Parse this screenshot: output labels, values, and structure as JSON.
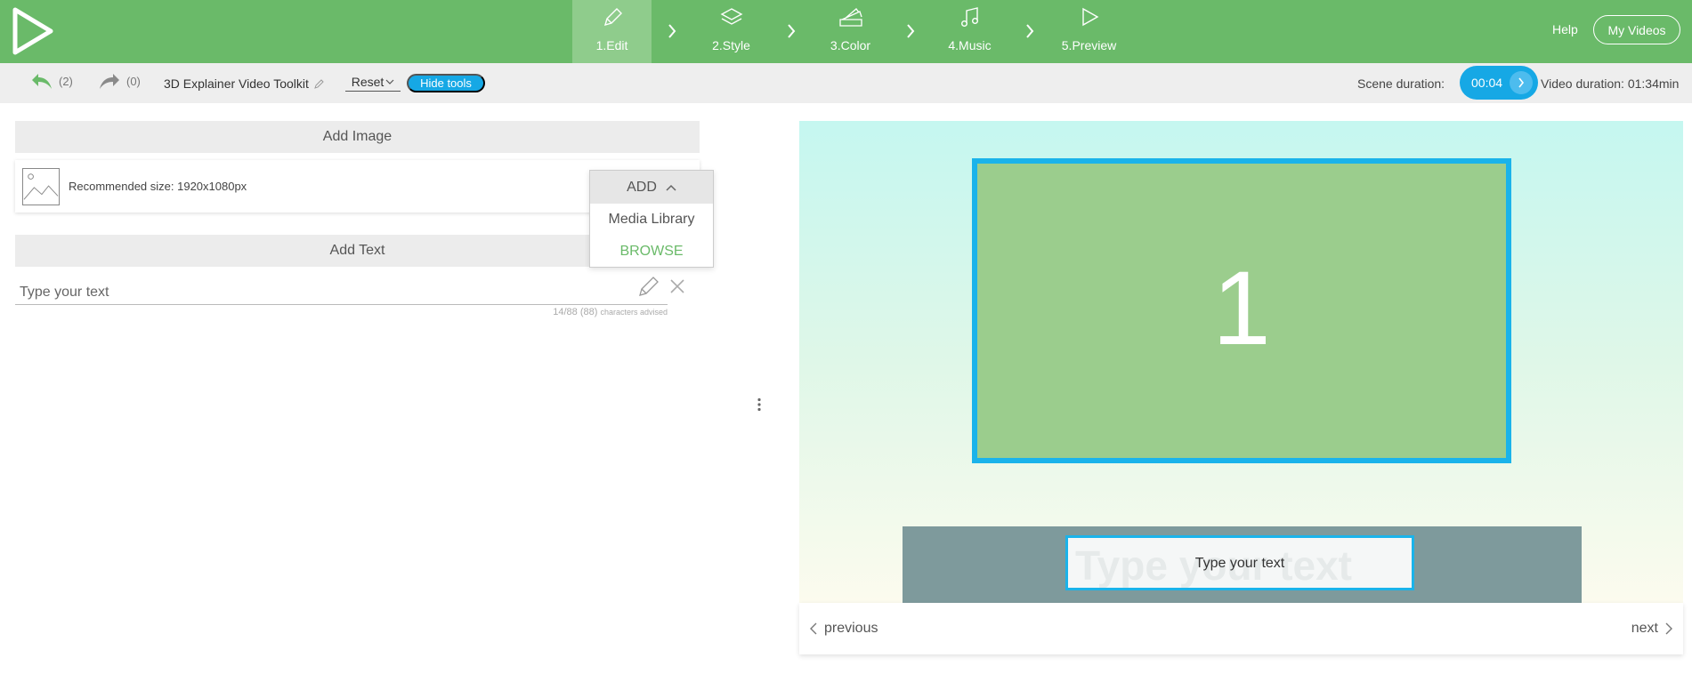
{
  "header": {
    "steps": [
      {
        "label": "1.Edit",
        "icon": "pencil-icon"
      },
      {
        "label": "2.Style",
        "icon": "layers-icon"
      },
      {
        "label": "3.Color",
        "icon": "swatches-icon"
      },
      {
        "label": "4.Music",
        "icon": "music-note-icon"
      },
      {
        "label": "5.Preview",
        "icon": "play-icon"
      }
    ],
    "help_label": "Help",
    "my_videos_label": "My Videos"
  },
  "toolbar": {
    "undo_count": "(2)",
    "redo_count": "(0)",
    "project_title": "3D Explainer Video Toolkit",
    "reset_label": "Reset",
    "hide_tools_label": "Hide tools",
    "scene_duration_label": "Scene duration:",
    "scene_duration_value": "00:04",
    "video_duration": "Video duration: 01:34min"
  },
  "editor": {
    "add_image_header": "Add Image",
    "recommended_size": "Recommended size: 1920x1080px",
    "add_dropdown": {
      "button_label": "ADD",
      "options": [
        "Media Library",
        "BROWSE"
      ]
    },
    "add_text_header": "Add Text",
    "text_placeholder": "Type your text",
    "char_count": "14/88 (88)",
    "char_hint": "characters advised"
  },
  "preview": {
    "slide_number": "1",
    "ghost_text": "Type your text",
    "text_box": "Type your text",
    "previous_label": "previous",
    "next_label": "next"
  },
  "colors": {
    "header_green": "#6aba69",
    "active_step": "#8fcc8c",
    "accent_blue": "#16a8e5"
  }
}
